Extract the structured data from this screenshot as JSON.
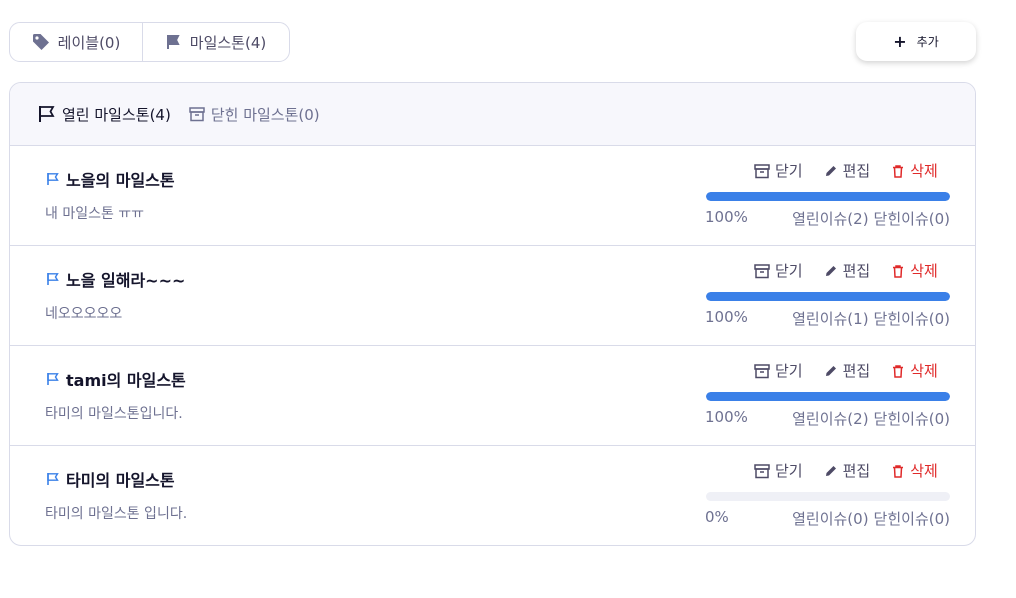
{
  "tabs": {
    "labels": "레이블(0)",
    "milestones": "마일스톤(4)"
  },
  "add_button": {
    "label": "추가"
  },
  "filters": {
    "open": "열린 마일스톤(4)",
    "closed": "닫힌 마일스톤(0)"
  },
  "action_labels": {
    "close": "닫기",
    "edit": "편집",
    "delete": "삭제"
  },
  "milestones": [
    {
      "title": "노을의 마일스톤",
      "description": "내 마일스톤 ㅠㅠ",
      "progress": 100,
      "percent_text": "100%",
      "open_issues": "열린이슈(2)",
      "closed_issues": "닫힌이슈(0)"
    },
    {
      "title": "노을 일해라~~~",
      "description": "네오오오오오",
      "progress": 100,
      "percent_text": "100%",
      "open_issues": "열린이슈(1)",
      "closed_issues": "닫힌이슈(0)"
    },
    {
      "title": "tami의 마일스톤",
      "description": "타미의 마일스톤입니다.",
      "progress": 100,
      "percent_text": "100%",
      "open_issues": "열린이슈(2)",
      "closed_issues": "닫힌이슈(0)"
    },
    {
      "title": "타미의 마일스톤",
      "description": "타미의 마일스톤 입니다.",
      "progress": 0,
      "percent_text": "0%",
      "open_issues": "열린이슈(0)",
      "closed_issues": "닫힌이슈(0)"
    }
  ],
  "colors": {
    "accent": "#3a80e8",
    "danger": "#e02a2a",
    "border": "#d9dbe9"
  }
}
